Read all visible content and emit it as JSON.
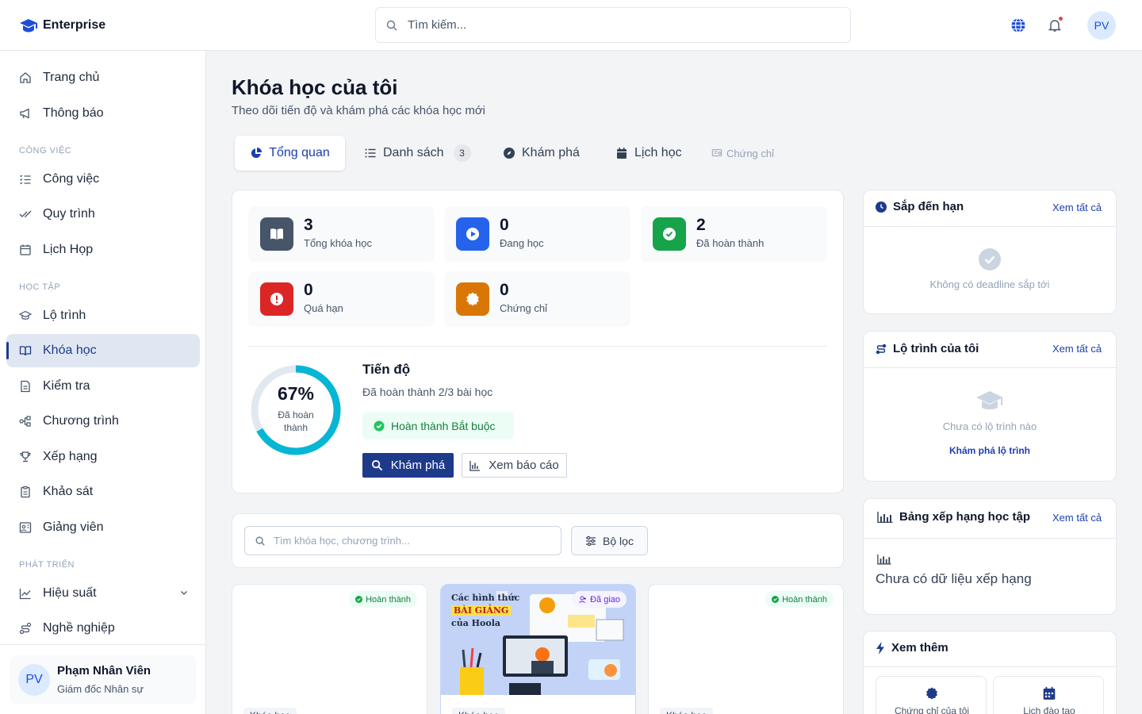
{
  "header": {
    "brand": "Enterprise",
    "search_placeholder": "Tìm kiếm...",
    "avatar_initials": "PV"
  },
  "sidebar": {
    "items_top": [
      {
        "label": "Trang chủ"
      },
      {
        "label": "Thông báo"
      }
    ],
    "section_work": "CÔNG VIỆC",
    "items_work": [
      {
        "label": "Công việc"
      },
      {
        "label": "Quy trình"
      },
      {
        "label": "Lịch Họp"
      }
    ],
    "section_learning": "HỌC TẬP",
    "items_learning": [
      {
        "label": "Lộ trình"
      },
      {
        "label": "Khóa học"
      },
      {
        "label": "Kiểm tra"
      },
      {
        "label": "Chương trình"
      },
      {
        "label": "Xếp hạng"
      },
      {
        "label": "Khảo sát"
      },
      {
        "label": "Giảng viên"
      }
    ],
    "section_dev": "PHÁT TRIỂN",
    "items_dev": [
      {
        "label": "Hiệu suất"
      },
      {
        "label": "Nghề nghiệp"
      }
    ],
    "user": {
      "initials": "PV",
      "name": "Phạm Nhân Viên",
      "role": "Giám đốc Nhân sự"
    }
  },
  "main": {
    "title": "Khóa học của tôi",
    "subtitle": "Theo dõi tiến độ và khám phá các khóa học mới",
    "tabs": [
      {
        "label": "Tổng quan"
      },
      {
        "label": "Danh sách",
        "count": "3"
      },
      {
        "label": "Khám phá"
      },
      {
        "label": "Lịch học"
      },
      {
        "label": "Chứng chỉ"
      }
    ],
    "stats": [
      {
        "value": "3",
        "label": "Tổng khóa học",
        "color": "#475569"
      },
      {
        "value": "0",
        "label": "Đang học",
        "color": "#2563eb"
      },
      {
        "value": "2",
        "label": "Đã hoàn thành",
        "color": "#16a34a"
      },
      {
        "value": "0",
        "label": "Quá hạn",
        "color": "#dc2626"
      },
      {
        "value": "0",
        "label": "Chứng chỉ",
        "color": "#d97706"
      }
    ],
    "progress": {
      "percent": 67,
      "percent_label": "67%",
      "ring_caption": "Đã hoàn thành",
      "title": "Tiến độ",
      "detail": "Đã hoàn thành 2/3 bài học",
      "badge": "Hoàn thành Bắt buộc",
      "explore_btn": "Khám phá",
      "report_btn": "Xem báo cáo"
    },
    "course_search_placeholder": "Tìm khóa học, chương trình...",
    "filter_btn": "Bộ lọc",
    "courses": [
      {
        "status": "Hoàn thành",
        "tag": "Khóa học"
      },
      {
        "status": "Đã giao",
        "tag": "Khóa học",
        "image_lines": [
          "Các hình thức",
          "BÀI GIẢNG",
          "của Hoola"
        ]
      },
      {
        "status": "Hoàn thành",
        "tag": "Khóa học"
      }
    ]
  },
  "right": {
    "deadlines": {
      "title": "Sắp đến hạn",
      "link": "Xem tất cả",
      "empty": "Không có deadline sắp tới"
    },
    "paths": {
      "title": "Lộ trình của tôi",
      "link": "Xem tất cả",
      "empty": "Chưa có lộ trình nào",
      "cta": "Khám phá lộ trình"
    },
    "ranking": {
      "title": "Bảng xếp hạng học tập",
      "link": "Xem tất cả",
      "empty": "Chưa có dữ liệu xếp hạng"
    },
    "more": {
      "title": "Xem thêm",
      "tiles": [
        {
          "label": "Chứng chỉ của tôi"
        },
        {
          "label": "Lịch đào tạo"
        }
      ]
    }
  },
  "colors": {
    "accent": "#1e3a8a",
    "ring": "#06b6d4",
    "success": "#16a34a"
  }
}
